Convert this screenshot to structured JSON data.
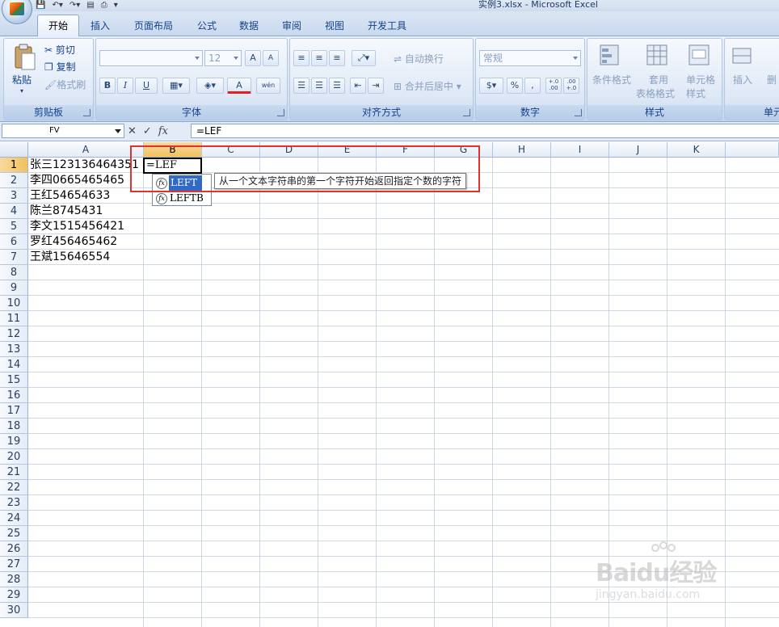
{
  "window": {
    "title": "实例3.xlsx - Microsoft Excel"
  },
  "tabs": [
    "开始",
    "插入",
    "页面布局",
    "公式",
    "数据",
    "审阅",
    "视图",
    "开发工具"
  ],
  "ribbon": {
    "clipboard": {
      "label": "剪贴板",
      "paste": "粘贴",
      "cut": "剪切",
      "copy": "复制",
      "format_painter": "格式刷"
    },
    "font": {
      "label": "字体",
      "size": "12",
      "bold": "B",
      "italic": "I",
      "underline": "U",
      "grow": "A",
      "shrink": "A",
      "font_color": "A",
      "phonetic": "wén"
    },
    "alignment": {
      "label": "对齐方式",
      "wrap": "自动换行",
      "merge": "合并后居中"
    },
    "number": {
      "label": "数字",
      "format": "常规",
      "percent": "%",
      "comma": ",",
      "inc_decimal": "+.0 .00",
      "dec_decimal": ".00 +.0"
    },
    "styles": {
      "label": "样式",
      "conditional": "条件格式",
      "table_style_1": "套用",
      "table_style_2": "表格格式",
      "cell_style_1": "单元格",
      "cell_style_2": "样式"
    },
    "cells": {
      "label": "单元",
      "insert": "插入",
      "delete": "删"
    }
  },
  "formula_bar": {
    "name_box": "FV",
    "cancel": "✕",
    "enter": "✓",
    "fx": "fx",
    "formula": "=LEF"
  },
  "columns": [
    "A",
    "B",
    "C",
    "D",
    "E",
    "F",
    "G",
    "H",
    "I",
    "J",
    "K"
  ],
  "rows": [
    "1",
    "2",
    "3",
    "4",
    "5",
    "6",
    "7",
    "8",
    "9",
    "10",
    "11",
    "12",
    "13",
    "14",
    "15",
    "16",
    "17",
    "18",
    "19",
    "20",
    "21",
    "22",
    "23",
    "24",
    "25",
    "26",
    "27",
    "28",
    "29",
    "30"
  ],
  "cells_data": [
    "张三123136464351",
    "李四0665465465",
    "王红54654633",
    "陈兰8745431",
    "李文1515456421",
    "罗红456465462",
    "王斌15646554"
  ],
  "active_cell": {
    "value": "=LEF"
  },
  "autocomplete": {
    "items": [
      "LEFT",
      "LEFTB"
    ],
    "tooltip": "从一个文本字符串的第一个字符开始返回指定个数的字符"
  },
  "watermark": {
    "logo": "Baidu经验",
    "url": "jingyan.baidu.com"
  },
  "colors": {
    "highlight": "#e0332e",
    "selected_item": "#316ac5",
    "header_selected": "#f1c15f"
  }
}
